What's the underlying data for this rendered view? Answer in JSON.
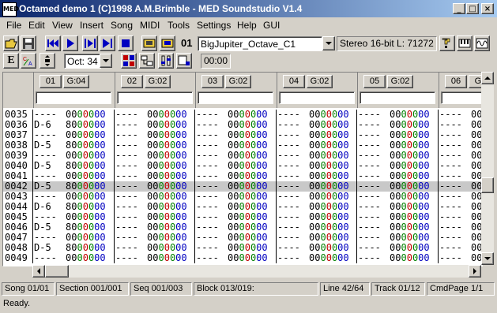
{
  "window": {
    "title": "Octamed demo 1 (C)1998 A.M.Brimble - MED Soundstudio V1.4",
    "icon_label": "MED",
    "minimize": "_",
    "maximize": "□",
    "close": "×"
  },
  "menu": [
    "File",
    "Edit",
    "View",
    "Insert",
    "Song",
    "MIDI",
    "Tools",
    "Settings",
    "Help",
    "GUI"
  ],
  "toolbar": {
    "instrument_number": "01",
    "instrument_name": "BigJupiter_Octave_C1",
    "sample_info": "Stereo 16-bit L: 71272",
    "octave": "Oct: 34",
    "time": "00:00",
    "e_label": "E"
  },
  "tracks": [
    {
      "num": "01",
      "group": "G:04"
    },
    {
      "num": "02",
      "group": "G:02"
    },
    {
      "num": "03",
      "group": "G:02"
    },
    {
      "num": "04",
      "group": "G:02"
    },
    {
      "num": "05",
      "group": "G:02"
    },
    {
      "num": "06",
      "group": "G:0"
    }
  ],
  "rows": [
    {
      "line": "0035",
      "notes": [
        "----",
        "----",
        "----",
        "----",
        "----",
        "----"
      ],
      "cmd": [
        "0000000",
        "0000000",
        "0000000",
        "0000000",
        "0000000",
        "00"
      ]
    },
    {
      "line": "0036",
      "notes": [
        "D-6",
        "----",
        "----",
        "----",
        "----",
        "----"
      ],
      "cmd": [
        "8000000",
        "0000000",
        "0000000",
        "0000000",
        "0000000",
        "00"
      ]
    },
    {
      "line": "0037",
      "notes": [
        "----",
        "----",
        "----",
        "----",
        "----",
        "----"
      ],
      "cmd": [
        "0000000",
        "0000000",
        "0000000",
        "0000000",
        "0000000",
        "00"
      ]
    },
    {
      "line": "0038",
      "notes": [
        "D-5",
        "----",
        "----",
        "----",
        "----",
        "----"
      ],
      "cmd": [
        "8000000",
        "0000000",
        "0000000",
        "0000000",
        "0000000",
        "00"
      ]
    },
    {
      "line": "0039",
      "notes": [
        "----",
        "----",
        "----",
        "----",
        "----",
        "----"
      ],
      "cmd": [
        "0000000",
        "0000000",
        "0000000",
        "0000000",
        "0000000",
        "00"
      ]
    },
    {
      "line": "0040",
      "notes": [
        "D-5",
        "----",
        "----",
        "----",
        "----",
        "----"
      ],
      "cmd": [
        "8000000",
        "0000000",
        "0000000",
        "0000000",
        "0000000",
        "00"
      ]
    },
    {
      "line": "0041",
      "notes": [
        "----",
        "----",
        "----",
        "----",
        "----",
        "----"
      ],
      "cmd": [
        "0000000",
        "0000000",
        "0000000",
        "0000000",
        "0000000",
        "00"
      ]
    },
    {
      "line": "0042",
      "notes": [
        "D-5",
        "----",
        "----",
        "----",
        "----",
        "----"
      ],
      "cmd": [
        "8000000",
        "0000000",
        "0000000",
        "0000000",
        "0000000",
        "00"
      ],
      "highlight": true
    },
    {
      "line": "0043",
      "notes": [
        "----",
        "----",
        "----",
        "----",
        "----",
        "----"
      ],
      "cmd": [
        "0000000",
        "0000000",
        "0000000",
        "0000000",
        "0000000",
        "00"
      ]
    },
    {
      "line": "0044",
      "notes": [
        "D-6",
        "----",
        "----",
        "----",
        "----",
        "----"
      ],
      "cmd": [
        "8000000",
        "0000000",
        "0000000",
        "0000000",
        "0000000",
        "00"
      ]
    },
    {
      "line": "0045",
      "notes": [
        "----",
        "----",
        "----",
        "----",
        "----",
        "----"
      ],
      "cmd": [
        "0000000",
        "0000000",
        "0000000",
        "0000000",
        "0000000",
        "00"
      ]
    },
    {
      "line": "0046",
      "notes": [
        "D-5",
        "----",
        "----",
        "----",
        "----",
        "----"
      ],
      "cmd": [
        "8000000",
        "0000000",
        "0000000",
        "0000000",
        "0000000",
        "00"
      ]
    },
    {
      "line": "0047",
      "notes": [
        "----",
        "----",
        "----",
        "----",
        "----",
        "----"
      ],
      "cmd": [
        "0000000",
        "0000000",
        "0000000",
        "0000000",
        "0000000",
        "00"
      ]
    },
    {
      "line": "0048",
      "notes": [
        "D-5",
        "----",
        "----",
        "----",
        "----",
        "----"
      ],
      "cmd": [
        "8000000",
        "0000000",
        "0000000",
        "0000000",
        "0000000",
        "00"
      ]
    },
    {
      "line": "0049",
      "notes": [
        "----",
        "----",
        "----",
        "----",
        "----",
        "----"
      ],
      "cmd": [
        "0000000",
        "0000000",
        "0000000",
        "0000000",
        "0000000",
        "00"
      ]
    }
  ],
  "status": {
    "song": "Song 01/01",
    "section": "Section 001/001",
    "seq": "Seq 001/003",
    "block": "Block 013/019:",
    "line": "Line 42/64",
    "track": "Track 01/12",
    "cmdpage": "CmdPage 1/1",
    "message": "Ready."
  },
  "colors": {
    "titlebar_start": "#0a246a",
    "titlebar_end": "#a6caf0",
    "cmd_green": "#008000",
    "cmd_red": "#c00000",
    "cmd_blue": "#0000c0",
    "highlight_row": "#c8c8c8"
  }
}
